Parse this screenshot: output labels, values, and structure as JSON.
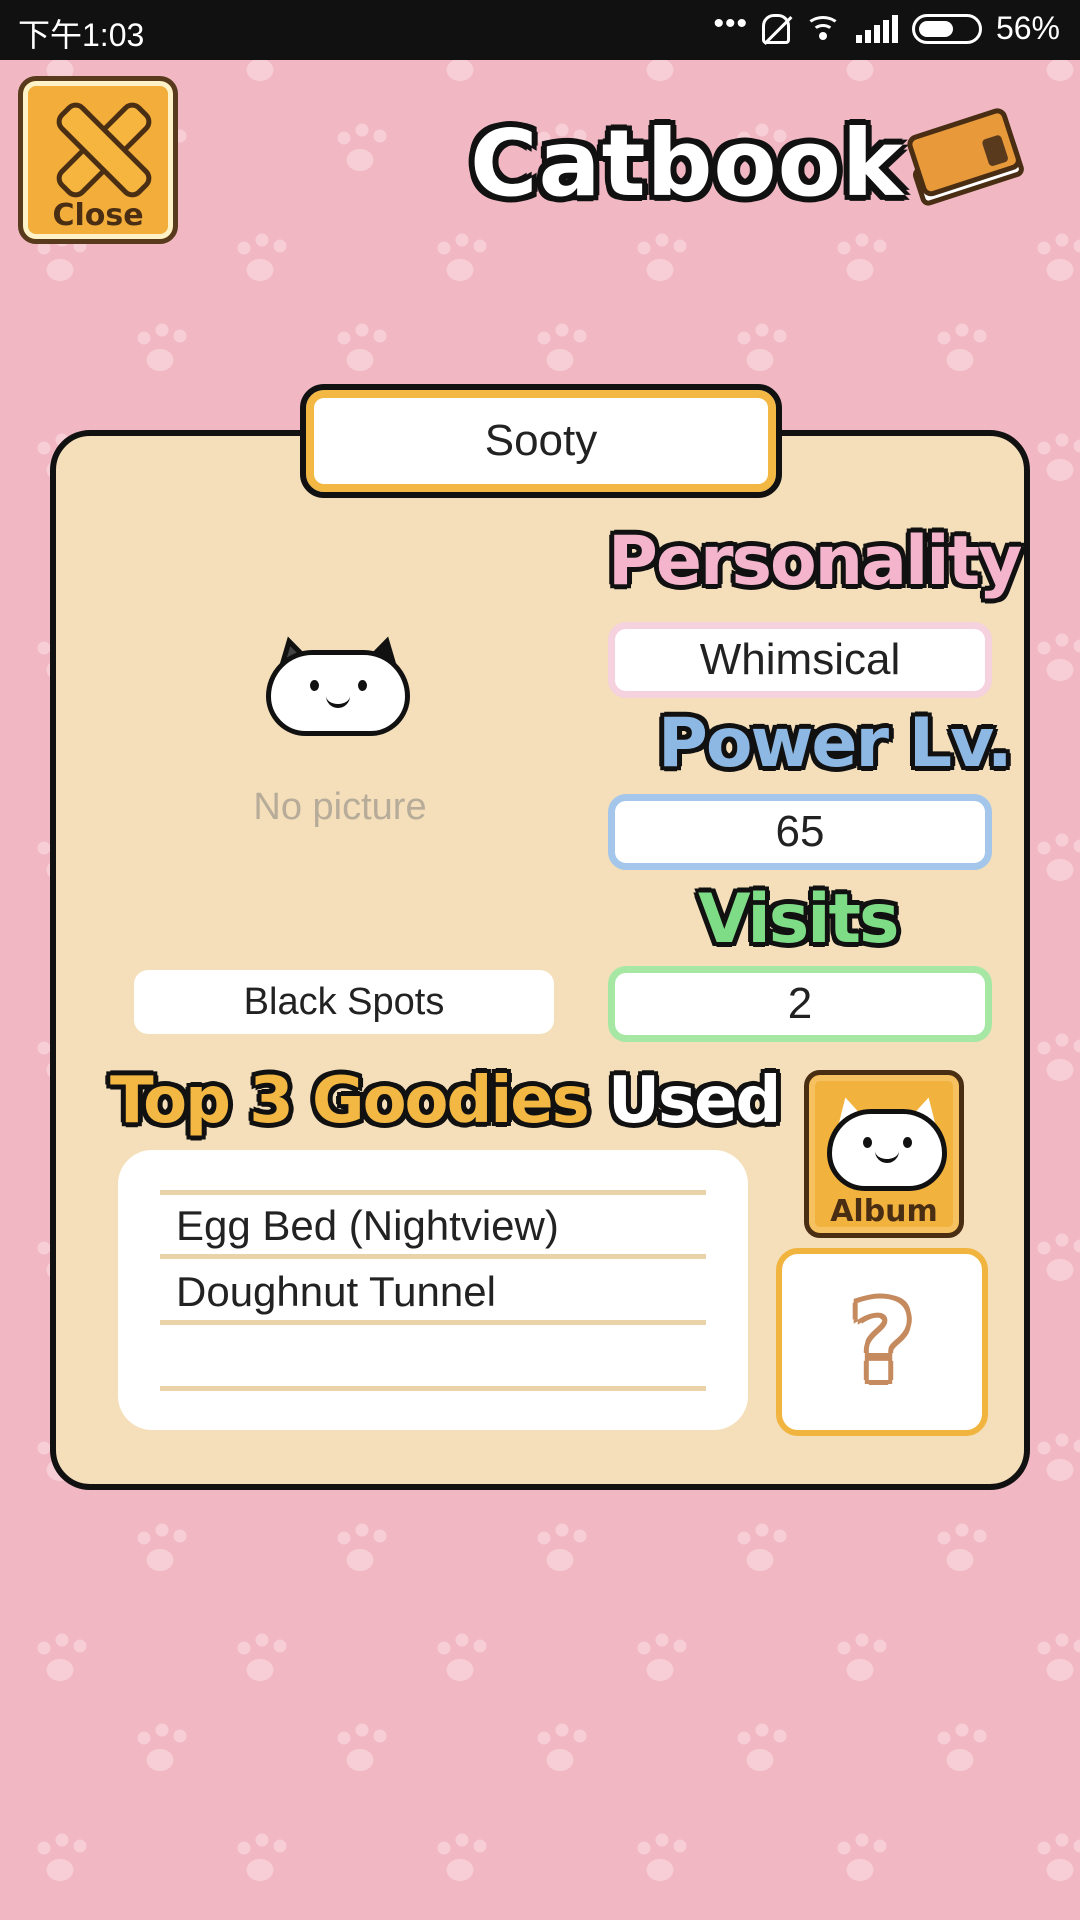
{
  "status_bar": {
    "time": "下午1:03",
    "battery": "56%",
    "icons": [
      "more-dots-icon",
      "bell-off-icon",
      "wifi-icon",
      "signal-icon",
      "battery-icon"
    ]
  },
  "header": {
    "close_label": "Close",
    "title": "Catbook",
    "book_icon": "catbook-icon"
  },
  "cat": {
    "name": "Sooty",
    "picture_placeholder": "No picture",
    "pattern": "Black Spots",
    "personality_label": "Personality",
    "personality": "Whimsical",
    "power_label": "Power Lv.",
    "power_level": "65",
    "visits_label": "Visits",
    "visits": "2"
  },
  "goodies": {
    "title_main": "Top 3 Goodies",
    "title_used": "Used",
    "items": [
      "Egg Bed (Nightview)",
      "Doughnut Tunnel",
      ""
    ]
  },
  "buttons": {
    "album_label": "Album",
    "mystery": "?"
  },
  "colors": {
    "background": "#f1b8c3",
    "card": "#f4dfba",
    "accent_orange": "#f3b843",
    "personality_pink": "#f4b5cc",
    "power_blue": "#8db8e4",
    "visits_green": "#7fdc86"
  }
}
